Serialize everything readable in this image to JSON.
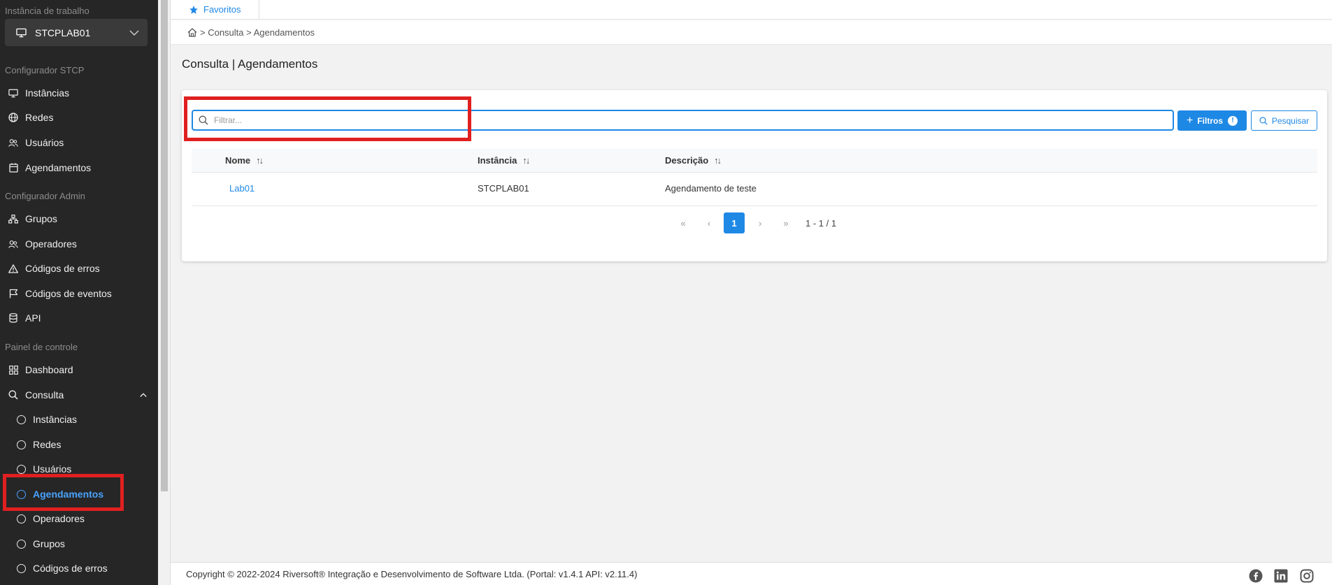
{
  "sidebar": {
    "workspace_label": "Instância de trabalho",
    "instance_value": "STCPLAB01",
    "sections": {
      "stcp": "Configurador STCP",
      "admin": "Configurador Admin",
      "panel": "Painel de controle"
    },
    "stcp_items": [
      "Instâncias",
      "Redes",
      "Usuários",
      "Agendamentos"
    ],
    "admin_items": [
      "Grupos",
      "Operadores",
      "Códigos de erros",
      "Códigos de eventos",
      "API"
    ],
    "panel_items": [
      "Dashboard",
      "Consulta"
    ],
    "consulta_subitems": [
      "Instâncias",
      "Redes",
      "Usuários",
      "Agendamentos",
      "Operadores",
      "Grupos",
      "Códigos de erros"
    ],
    "active_item": "Agendamentos"
  },
  "topbar": {
    "favorites_label": "Favoritos"
  },
  "breadcrumb": {
    "text": "> Consulta > Agendamentos"
  },
  "page": {
    "title": "Consulta | Agendamentos"
  },
  "filter": {
    "placeholder": "Filtrar...",
    "filters_label": "Filtros",
    "filters_badge": "!",
    "search_label": "Pesquisar"
  },
  "table": {
    "columns": [
      "Nome",
      "Instância",
      "Descrição"
    ],
    "rows": [
      {
        "nome": "Lab01",
        "instancia": "STCPLAB01",
        "descricao": "Agendamento de teste"
      }
    ]
  },
  "pagination": {
    "current": "1",
    "info": "1 - 1 / 1"
  },
  "footer": {
    "copyright": "Copyright © 2022-2024 Riversoft® Integração e Desenvolvimento de Software Ltda. (Portal: v1.4.1 API: v2.11.4)"
  },
  "colors": {
    "accent": "#1e88e5",
    "sidebar_bg": "#262626",
    "highlight": "#e02020"
  }
}
